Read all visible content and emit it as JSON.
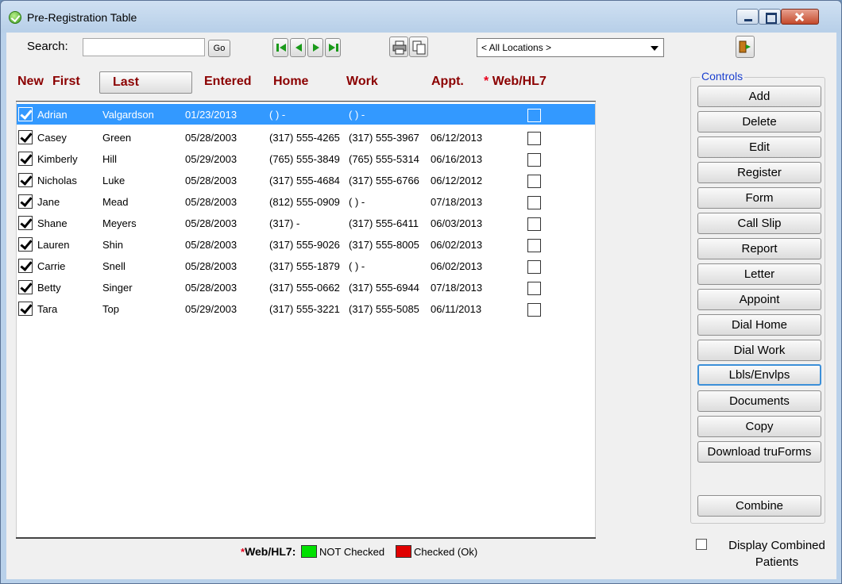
{
  "window": {
    "title": "Pre-Registration Table"
  },
  "toolbar": {
    "search_label": "Search:",
    "search_value": "",
    "go_label": "Go",
    "location": "< All Locations >"
  },
  "columns": {
    "new": "New",
    "first": "First",
    "last": "Last",
    "entered": "Entered",
    "home": "Home",
    "work": "Work",
    "appt": "Appt.",
    "star": "*",
    "web": "Web/HL7"
  },
  "rows": [
    {
      "first": "Adrian",
      "last": "Valgardson",
      "entered": "01/23/2013",
      "home": "(   )    -",
      "work": "(   )    -",
      "appt": "",
      "selected": true
    },
    {
      "first": "Casey",
      "last": "Green",
      "entered": "05/28/2003",
      "home": "(317) 555-4265",
      "work": "(317) 555-3967",
      "appt": "06/12/2013"
    },
    {
      "first": "Kimberly",
      "last": "Hill",
      "entered": "05/29/2003",
      "home": "(765) 555-3849",
      "work": "(765) 555-5314",
      "appt": "06/16/2013"
    },
    {
      "first": "Nicholas",
      "last": "Luke",
      "entered": "05/28/2003",
      "home": "(317) 555-4684",
      "work": "(317) 555-6766",
      "appt": "06/12/2012"
    },
    {
      "first": "Jane",
      "last": "Mead",
      "entered": "05/28/2003",
      "home": "(812) 555-0909",
      "work": "(   )    -",
      "appt": "07/18/2013"
    },
    {
      "first": "Shane",
      "last": "Meyers",
      "entered": "05/28/2003",
      "home": "(317)    -",
      "work": "(317) 555-6411",
      "appt": "06/03/2013"
    },
    {
      "first": "Lauren",
      "last": "Shin",
      "entered": "05/28/2003",
      "home": "(317) 555-9026",
      "work": "(317) 555-8005",
      "appt": "06/02/2013"
    },
    {
      "first": "Carrie",
      "last": "Snell",
      "entered": "05/28/2003",
      "home": "(317) 555-1879",
      "work": "(   )    -",
      "appt": "06/02/2013"
    },
    {
      "first": "Betty",
      "last": "Singer",
      "entered": "05/28/2003",
      "home": "(317) 555-0662",
      "work": "(317) 555-6944",
      "appt": "07/18/2013"
    },
    {
      "first": "Tara",
      "last": "Top",
      "entered": "05/29/2003",
      "home": "(317) 555-3221",
      "work": "(317) 555-5085",
      "appt": "06/11/2013"
    }
  ],
  "legend": {
    "star": "*",
    "title": "Web/HL7:",
    "not_checked": "NOT Checked",
    "checked": "Checked (Ok)",
    "not_checked_color": "#00e000",
    "checked_color": "#e00000"
  },
  "controls": {
    "title": "Controls",
    "buttons": [
      "Add",
      "Delete",
      "Edit",
      "Register",
      "Form",
      "Call Slip",
      "Report",
      "Letter",
      "Appoint",
      "Dial Home",
      "Dial Work",
      "Lbls/Envlps",
      "Documents",
      "Copy",
      "Download truForms"
    ],
    "combine": "Combine"
  },
  "display_combined": {
    "label": "Display Combined Patients",
    "checked": false
  }
}
